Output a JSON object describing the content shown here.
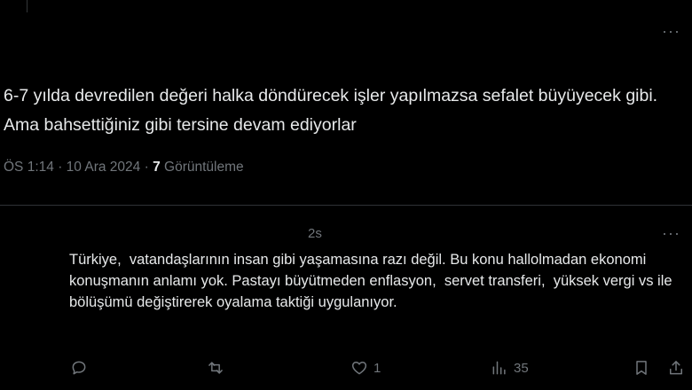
{
  "top_tweet": {
    "text": "6-7 yılda devredilen değeri halka döndürecek işler yapılmazsa sefalet büyüyecek gibi. Ama bahsettiğiniz gibi tersine devam ediyorlar",
    "time": "ÖS 1:14",
    "sep1": "·",
    "date": "10 Ara 2024",
    "sep2": "·",
    "views_count": "7",
    "views_label": "Görüntüleme",
    "more_label": "···"
  },
  "reply": {
    "time": "2s",
    "text": "Türkiye,  vatandaşlarının insan gibi yaşamasına razı değil. Bu konu hallolmadan ekonomi konuşmanın anlamı yok. Pastayı büyütmeden enflasyon,  servet transferi,  yüksek vergi vs ile bölüşümü değiştirerek oyalama taktiği uygulanıyor.",
    "more_label": "···",
    "actions": {
      "reply_count": "",
      "retweet_count": "",
      "like_count": "1",
      "views_count": "35"
    }
  },
  "colors": {
    "background": "#000000",
    "text": "#e7e9ea",
    "secondary": "#71767b",
    "divider": "#2f3336"
  },
  "icons": [
    "more-icon",
    "reply-icon",
    "retweet-icon",
    "like-icon",
    "views-icon",
    "bookmark-icon",
    "share-icon"
  ]
}
